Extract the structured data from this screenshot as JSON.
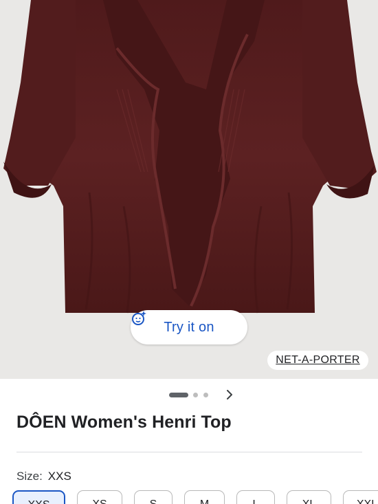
{
  "product": {
    "title": "DÔEN Women's Henri Top",
    "image_alt": "Burgundy ruffled cotton blouse",
    "try_on_label": "Try it on",
    "source_label": "NET-A-PORTER",
    "colors": {
      "garment": "#5a1f1f",
      "accent": "#1a56c4"
    }
  },
  "gallery": {
    "pages": 3,
    "current_page": 1
  },
  "size": {
    "label": "Size:",
    "selected": "XXS",
    "options": [
      "XXS",
      "XS",
      "S",
      "M",
      "L",
      "XL",
      "XXL"
    ]
  },
  "icons": {
    "try_on": "sparkle-face-icon",
    "next": "chevron-right-icon"
  }
}
